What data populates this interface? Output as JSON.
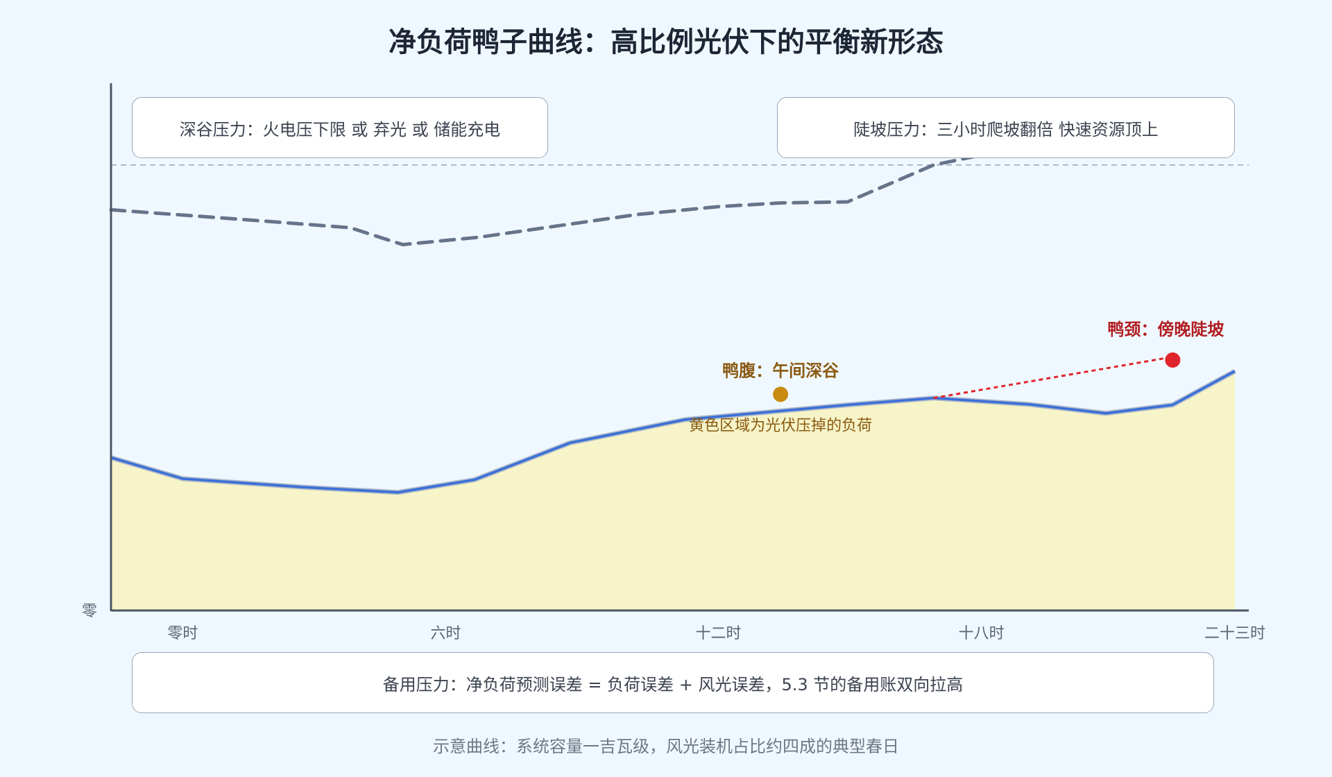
{
  "title": "净负荷鸭子曲线：高比例光伏下的平衡新形态",
  "callouts": {
    "valley": "深谷压力：火电压下限 或 弃光 或 储能充电",
    "ramp": "陡坡压力：三小时爬坡翻倍 快速资源顶上",
    "reserve": "备用压力：净负荷预测误差 = 负荷误差 + 风光误差，5.3 节的备用账双向拉高"
  },
  "footnote": "示意曲线：系统容量一吉瓦级，风光装机占比约四成的典型春日",
  "colors": {
    "net_load_line": "#3a6fd8",
    "net_load_fill": "#f6f4c8",
    "load_line": "#66748a",
    "axis": "#4b5563",
    "belly": "#c98a10",
    "neck": "#e0242c",
    "neck_label": "#b11e22",
    "belly_label": "#8a5a12"
  },
  "chart_data": {
    "type": "area",
    "title": "净负荷鸭子曲线：高比例光伏下的平衡新形态",
    "xlabel": "",
    "ylabel": "",
    "x": [
      0,
      1.5,
      4,
      6,
      7.6,
      9.6,
      12,
      15.4,
      17.2,
      19.2,
      20.8,
      22.2,
      23.5
    ],
    "xlim": [
      0,
      23.5
    ],
    "ylim": [
      0,
      100
    ],
    "x_ticks": [
      {
        "x": 1.5,
        "label": "零时"
      },
      {
        "x": 7.0,
        "label": "六时"
      },
      {
        "x": 12.7,
        "label": "十二时"
      },
      {
        "x": 18.2,
        "label": "十八时"
      },
      {
        "x": 23.5,
        "label": "二十三时"
      }
    ],
    "y_ticks": [
      {
        "y": 0,
        "label": "零"
      }
    ],
    "series": [
      {
        "kind": "total_load",
        "style": "dashed",
        "x": [
          0,
          3,
          5,
          6.1,
          7.7,
          9.3,
          11,
          12.7,
          14,
          15.4,
          17.2,
          18.8,
          20.8
        ],
        "values": [
          76,
          74,
          72.6,
          69.4,
          70.8,
          72.9,
          75.1,
          76.6,
          77.3,
          77.5,
          84.5,
          87.5,
          92
        ]
      },
      {
        "kind": "net_load",
        "style": "solid",
        "x": [
          0,
          1.5,
          4,
          6,
          7.6,
          9.6,
          12,
          15.4,
          17.2,
          19.2,
          20.8,
          22.2,
          23.5
        ],
        "values": [
          29,
          25,
          23.4,
          22.4,
          24.8,
          31.8,
          36.2,
          39,
          40.3,
          39.1,
          37.4,
          39,
          45.4
        ]
      }
    ],
    "reserve_line_y": 84.5,
    "neck_trend": {
      "x": [
        17.2,
        22.2
      ],
      "y": [
        40.3,
        48.1
      ]
    },
    "annotations": [
      {
        "id": "belly",
        "x": 14,
        "y": 41,
        "label": "鸭腹：午间深谷",
        "note": "黄色区域为光伏压掉的负荷"
      },
      {
        "id": "neck",
        "x": 22.2,
        "y": 47.5,
        "label": "鸭颈：傍晚陡坡"
      }
    ]
  }
}
